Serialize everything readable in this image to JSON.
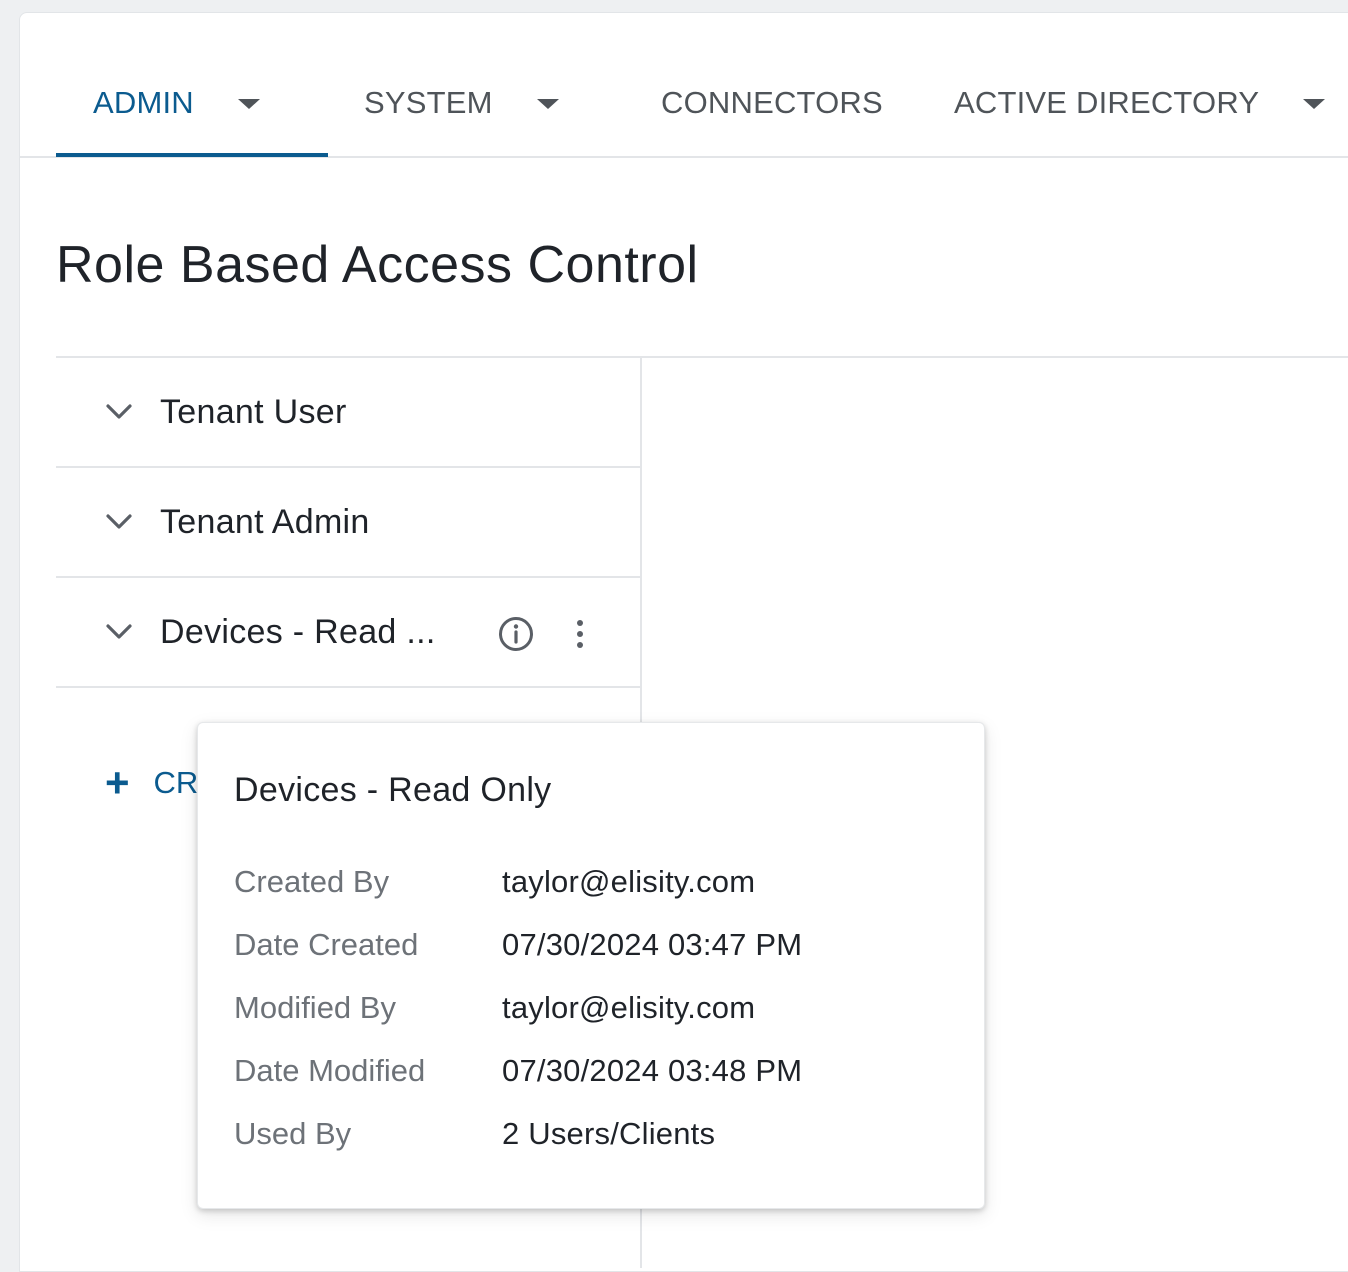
{
  "tabs": [
    {
      "label": "ADMIN",
      "has_dropdown": true,
      "active": true
    },
    {
      "label": "SYSTEM",
      "has_dropdown": true,
      "active": false
    },
    {
      "label": "CONNECTORS",
      "has_dropdown": false,
      "active": false
    },
    {
      "label": "ACTIVE DIRECTORY",
      "has_dropdown": true,
      "active": false
    }
  ],
  "page": {
    "title": "Role Based Access Control"
  },
  "roles": [
    {
      "label": "Tenant User",
      "icon": "chevron-down-icon"
    },
    {
      "label": "Tenant Admin",
      "icon": "chevron-down-icon"
    },
    {
      "label": "Devices - Read ...",
      "icon": "chevron-down-icon",
      "actions": [
        "info-icon",
        "more-vertical-icon"
      ]
    }
  ],
  "create_button": {
    "label": "CR",
    "icon": "plus-icon"
  },
  "popover": {
    "title": "Devices - Read Only",
    "fields": [
      {
        "key": "Created By",
        "value": "taylor@elisity.com"
      },
      {
        "key": "Date Created",
        "value": "07/30/2024 03:47 PM"
      },
      {
        "key": "Modified By",
        "value": "taylor@elisity.com"
      },
      {
        "key": "Date Modified",
        "value": "07/30/2024 03:48 PM"
      },
      {
        "key": "Used By",
        "value": "2 Users/Clients"
      }
    ]
  },
  "colors": {
    "accent": "#0b5b8f",
    "text": "#1f2329",
    "muted": "#6d7278",
    "divider": "#e3e5e8"
  }
}
